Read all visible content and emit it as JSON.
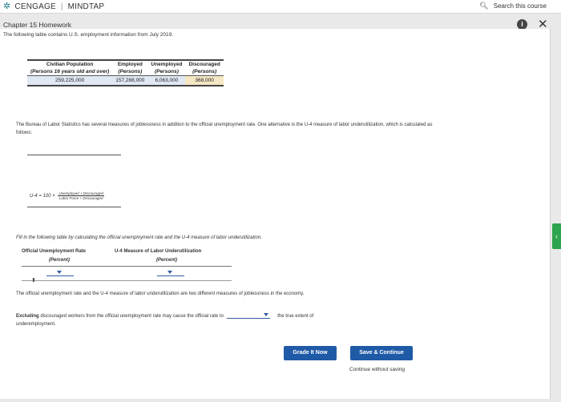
{
  "brand": {
    "name_left": "CENGAGE",
    "separator": "|",
    "name_right": "MINDTAP"
  },
  "search": {
    "label": "Search this course"
  },
  "header": {
    "chapter_title": "Chapter 15 Homework",
    "info_glyph": "i",
    "close_glyph": "✕"
  },
  "intro": {
    "clipped_text": "The following table contains U.S. employment information from July 2019."
  },
  "data_table": {
    "headers_row1": [
      "Civilian Population",
      "Employed",
      "Unemployed",
      "Discouraged"
    ],
    "headers_row2": [
      "(Persons 16 years old and over)",
      "(Persons)",
      "(Persons)",
      "(Persons)"
    ],
    "values": [
      "259,225,000",
      "157,288,000",
      "6,063,000",
      "368,000"
    ]
  },
  "paragraph1": "The Bureau of Labor Statistics has several measures of joblessness in addition to the official unemployment rate. One alternative is the U-4 measure of labor underutilization, which is calculated as follows:",
  "formula": {
    "lhs": "U-4",
    "equals": "=",
    "factor": "100 ×",
    "numerator": "Unemployed + Discouraged",
    "denominator": "Labor Force + Discouraged"
  },
  "instruction": "Fill in the following table by calculating the official unemployment rate and the U-4 measure of labor underutilization.",
  "answer_table": {
    "col1_header": "Official Unemployment Rate",
    "col1_sub": "(Percent)",
    "col2_header": "U-4 Measure of Labor Underutilization",
    "col2_sub": "(Percent)"
  },
  "paragraph2": "The official unemployment rate and the U-4 measure of labor underutilization are two different measures of joblessness in the economy.",
  "paragraph3": {
    "bold_lead": "Excluding",
    "text_before": "discouraged workers from the official unemployment rate may cause the official rate to",
    "text_after": "the true extent of",
    "text_line2": "underemployment."
  },
  "buttons": {
    "grade": "Grade It Now",
    "save": "Save & Continue",
    "skip": "Continue without saving"
  },
  "colors": {
    "primary_button": "#1f5aa6",
    "side_tab": "#2da44e"
  }
}
